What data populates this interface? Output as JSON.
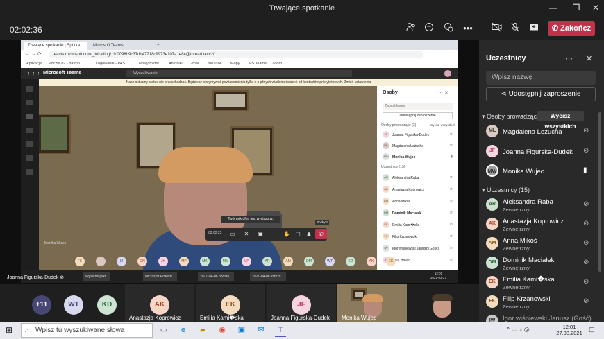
{
  "window": {
    "title": "Trwające spotkanie",
    "controls": [
      "—",
      "❐",
      "✕"
    ]
  },
  "meeting": {
    "timer": "02:02:36",
    "leave_label": "Zakończ",
    "toolbar_icons": [
      "people-icon",
      "chat-icon",
      "reactions-icon",
      "more-icon",
      "camera-off-icon",
      "mic-off-icon",
      "share-icon"
    ]
  },
  "shared": {
    "tabs": [
      {
        "label": "Trwające spotkanie | Spotka..."
      },
      {
        "label": "Microsoft Teams"
      }
    ],
    "address": "teams.microsoft.com/_#/calling/19:0098b9c37db47718c9973e107a1e84@thread.tacv2/",
    "bookmarks": [
      "Aplikacje",
      "Poczta o2 - darmo...",
      "Logowanie - PAST...",
      "Nowy folder",
      "Antoniki",
      "Gmail",
      "YouTube",
      "Mapy",
      "MS Teams",
      "Zoom"
    ],
    "teams_title": "Microsoft Teams",
    "teams_search": "Wyszukiwanie",
    "notice": "Nasz aktualny status nie przeszkadzać. Będziesz otrzymywać powiadomienia tylko z o pilnych wiadomościach i od kontaktów priorytetowych. Zmień ustawienia",
    "tooltip": "Twój mikrofon jest wyciszony.",
    "tooltip_leave": "Rozłącz",
    "call_time": "02:02:23",
    "video_name": "Monika Wujec",
    "sharer": "Joanna Figurska-Dudek",
    "strip": [
      "FK",
      "",
      "IJ",
      "ON",
      "JH",
      "MP",
      "MK",
      "MM",
      "MP",
      "AR",
      "AM",
      "DM",
      "WT",
      "KD",
      "AK",
      "EK"
    ],
    "panel": {
      "title": "Osoby",
      "invite_placeholder": "Zaproś kogoś",
      "share_label": "Udostępnij zaproszenie",
      "organizers_label": "Osoby prowadzące (3)",
      "mute_all": "Wycisz wszystkich",
      "organizers": [
        {
          "initials": "JF",
          "name": "Joanna Figurska-Dudek"
        },
        {
          "initials": "ML",
          "name": "Magdalena Leżucha"
        },
        {
          "initials": "MW",
          "name": "Monika Wujec"
        }
      ],
      "attendees_label": "Uczestnicy (15)",
      "attendees": [
        {
          "initials": "AR",
          "name": "Aleksandra Raba"
        },
        {
          "initials": "AK",
          "name": "Anastazja Koprowicz"
        },
        {
          "initials": "AM",
          "name": "Anna Mikoś"
        },
        {
          "initials": "DM",
          "name": "Dominik Maciałek"
        },
        {
          "initials": "EK",
          "name": "Emilia Kami�ska"
        },
        {
          "initials": "FK",
          "name": "Filip Krzanowski"
        },
        {
          "initials": "IW",
          "name": "Igor wiśniewski Janusz (Gość)"
        },
        {
          "initials": "JH",
          "name": "Julia Hawro"
        }
      ]
    },
    "taskbar_items": [
      "Wyślane pliki...",
      "Microsoft PowerP...",
      "2021-04-06 podsta...",
      "2021-04-06 krzyżó..."
    ],
    "taskbar_time": "12:01",
    "taskbar_date": "2021-03-27"
  },
  "participants": {
    "title": "Uczestnicy",
    "search_placeholder": "Wpisz nazwę",
    "share_label": "Udostępnij zaproszenie",
    "organizers_label": "Osoby prowadzące (3)",
    "mute_all": "Wycisz wszystkich",
    "organizers": [
      {
        "initials": "ML",
        "name": "Magdalena Leżucha",
        "color": "#d9c7c0",
        "text": "#333"
      },
      {
        "initials": "JF",
        "name": "Joanna Figurska-Dudek",
        "color": "#f5d5df",
        "text": "#c03b6a"
      },
      {
        "initials": "MW",
        "name": "Monika Wujec",
        "color": "#9b9b9b",
        "text": "#333"
      }
    ],
    "attendees_label": "Uczestnicy (15)",
    "attendees": [
      {
        "initials": "AR",
        "name": "Aleksandra Raba",
        "sub": "Zewnętrzny",
        "color": "#cfe0d1",
        "text": "#2e6b3d"
      },
      {
        "initials": "AK",
        "name": "Anastazja Koprowicz",
        "sub": "Zewnętrzny",
        "color": "#f7d6c7",
        "text": "#a0442a"
      },
      {
        "initials": "AM",
        "name": "Anna Mikoś",
        "sub": "Zewnętrzny",
        "color": "#f4dcc1",
        "text": "#8c5a1f"
      },
      {
        "initials": "DM",
        "name": "Dominik Maciałek",
        "sub": "Zewnętrzny",
        "color": "#cde3d3",
        "text": "#2e6b3d"
      },
      {
        "initials": "EK",
        "name": "Emilia Kami�ska",
        "sub": "Zewnętrzny",
        "color": "#f7d6c7",
        "text": "#a0442a"
      },
      {
        "initials": "FK",
        "name": "Filip Krzanowski",
        "sub": "Zewnętrzny",
        "color": "#f4dcc1",
        "text": "#8c5a1f"
      },
      {
        "initials": "IW",
        "name": "Igor wiśniewski Janusz (Gość)",
        "sub": "",
        "color": "#c8c8c8",
        "text": "#333"
      }
    ]
  },
  "gallery": [
    {
      "initials": "+11",
      "name": "",
      "color": "#464775",
      "text": "#fff"
    },
    {
      "initials": "WT",
      "name": "",
      "color": "#d8d8ef",
      "text": "#464775"
    },
    {
      "initials": "KD",
      "name": "",
      "color": "#cde3d3",
      "text": "#2e6b3d"
    },
    {
      "initials": "AK",
      "name": "Anastazja Koprowicz",
      "color": "#f7d6c7",
      "text": "#a0442a"
    },
    {
      "initials": "EK",
      "name": "Emilia Kami�ska",
      "color": "#f4dcc1",
      "text": "#8c5a1f"
    },
    {
      "initials": "JF",
      "name": "Joanna Figurska-Dudek",
      "color": "#f5d5df",
      "text": "#c03b6a"
    },
    {
      "initials": "",
      "name": "Monika Wujec",
      "color": "#7a6a50",
      "text": "#fff"
    }
  ],
  "taskbar": {
    "search_placeholder": "Wpisz tu wyszukiwane słowa",
    "time": "12:01",
    "date": "27.03.2021"
  }
}
